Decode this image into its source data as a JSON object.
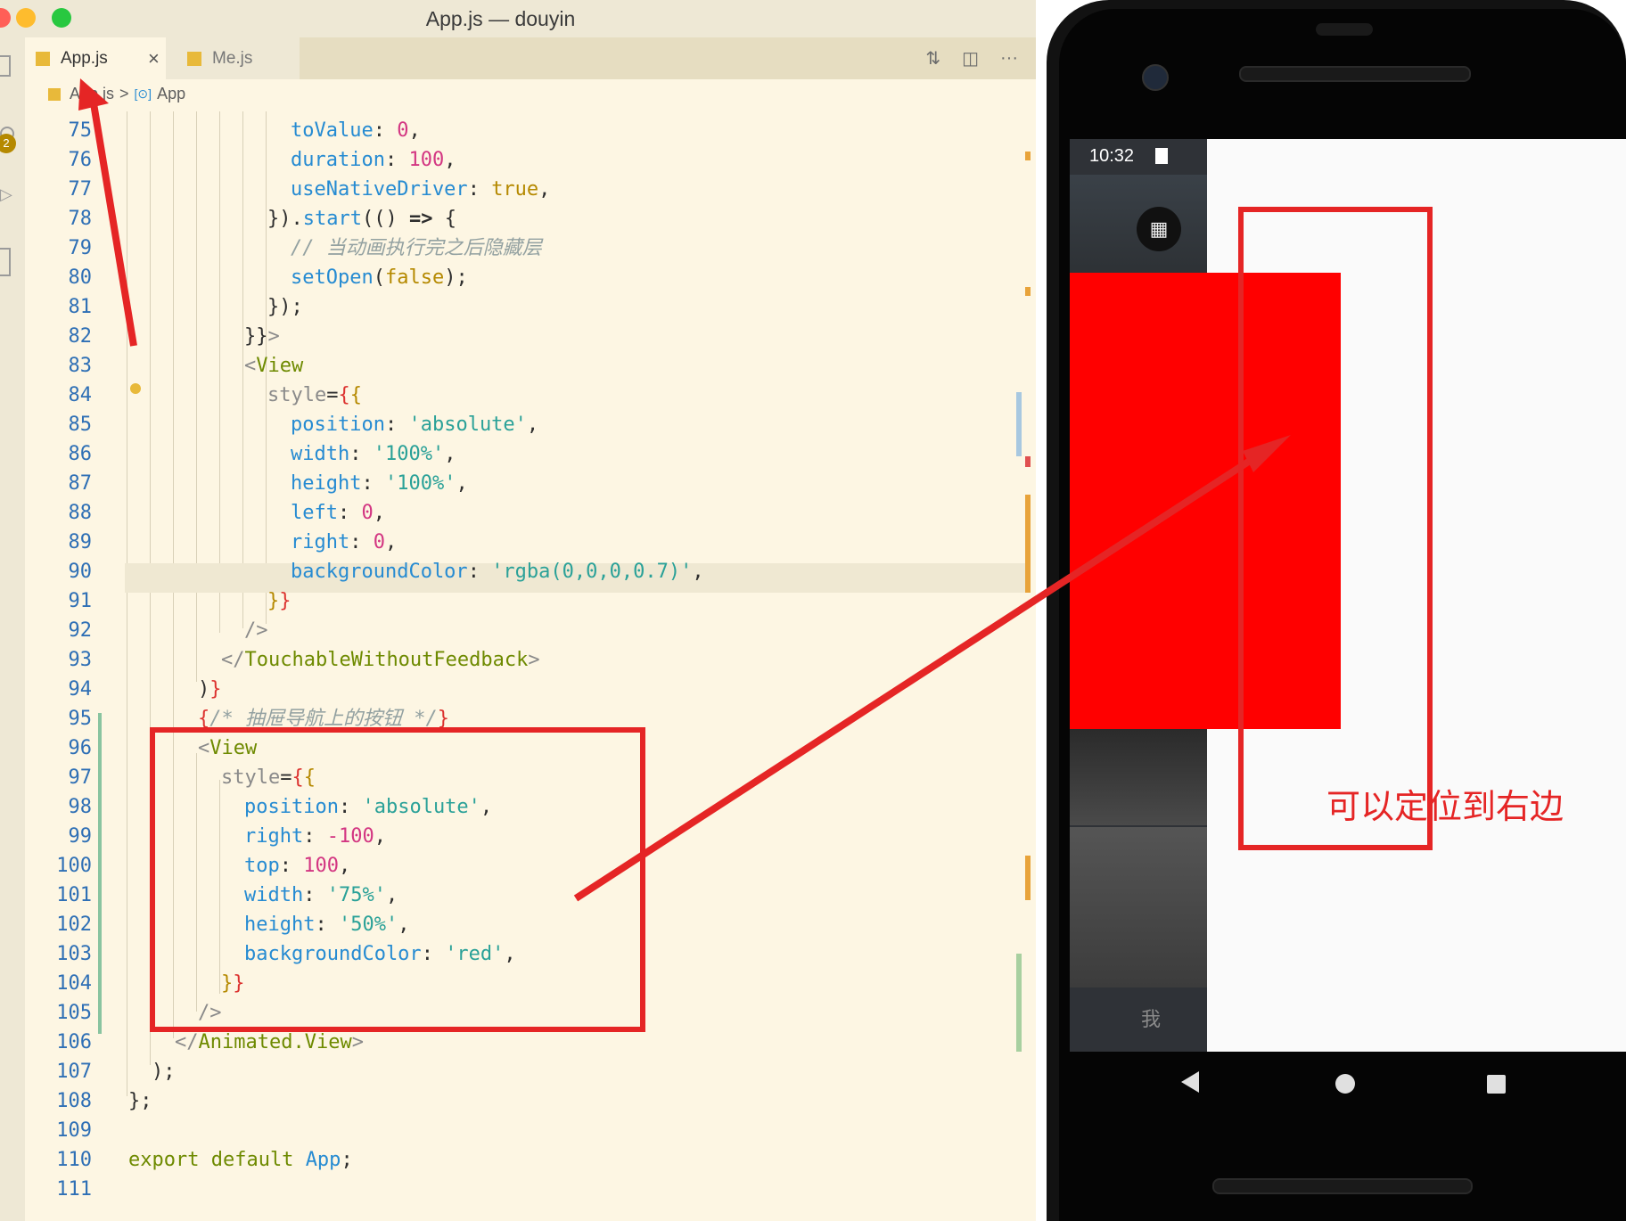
{
  "window": {
    "title": "App.js — douyin"
  },
  "tabs": [
    {
      "label": "App.js",
      "active": true,
      "close": "×"
    },
    {
      "label": "Me.js",
      "active": false
    }
  ],
  "activity_badge": "2",
  "breadcrumb": {
    "file": "App.js",
    "separator": ">",
    "symbol": "App"
  },
  "lines": [
    {
      "n": "75"
    },
    {
      "n": "76"
    },
    {
      "n": "77"
    },
    {
      "n": "78"
    },
    {
      "n": "79"
    },
    {
      "n": "80"
    },
    {
      "n": "81"
    },
    {
      "n": "82"
    },
    {
      "n": "83"
    },
    {
      "n": "84"
    },
    {
      "n": "85"
    },
    {
      "n": "86"
    },
    {
      "n": "87"
    },
    {
      "n": "88"
    },
    {
      "n": "89"
    },
    {
      "n": "90"
    },
    {
      "n": "91"
    },
    {
      "n": "92"
    },
    {
      "n": "93"
    },
    {
      "n": "94"
    },
    {
      "n": "95"
    },
    {
      "n": "96"
    },
    {
      "n": "97"
    },
    {
      "n": "98"
    },
    {
      "n": "99"
    },
    {
      "n": "100"
    },
    {
      "n": "101"
    },
    {
      "n": "102"
    },
    {
      "n": "103"
    },
    {
      "n": "104"
    },
    {
      "n": "105"
    },
    {
      "n": "106"
    },
    {
      "n": "107"
    },
    {
      "n": "108"
    },
    {
      "n": "109"
    },
    {
      "n": "110"
    },
    {
      "n": "111"
    }
  ],
  "phone": {
    "time": "10:32",
    "tab_label": "我",
    "annotation": "可以定位到右边"
  },
  "colors": {
    "annotation": "#E52525",
    "red_view": "#FF0000",
    "editor_bg": "#FDF6E3"
  }
}
